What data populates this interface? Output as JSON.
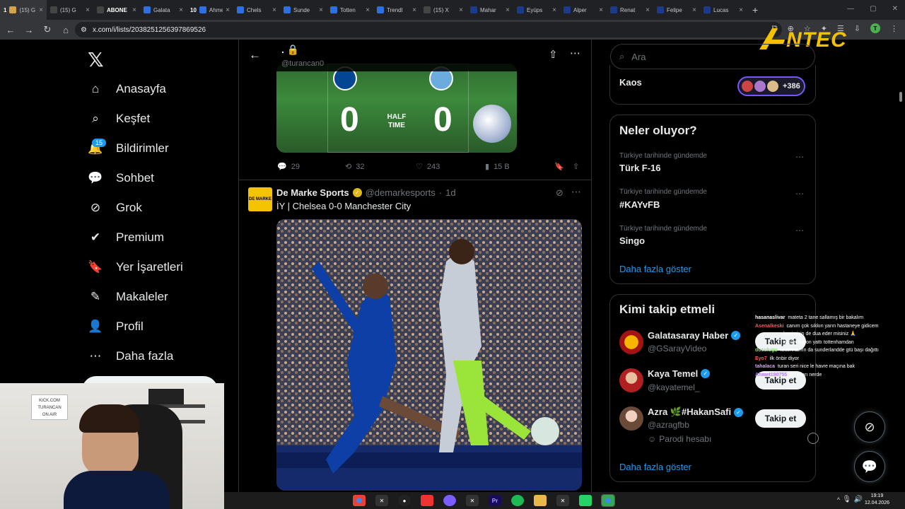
{
  "browser": {
    "tabs": [
      {
        "label": "(15) G",
        "color": "#d4a44a",
        "prefix": "1"
      },
      {
        "label": "(15) G",
        "color": "#444"
      },
      {
        "label": "ABONE",
        "color": "#444"
      },
      {
        "label": "Galata",
        "color": "#2f6fe4"
      },
      {
        "label": "Ahme",
        "color": "#2f6fe4",
        "prefix": "10"
      },
      {
        "label": "Chels",
        "color": "#2f6fe4"
      },
      {
        "label": "Sunde",
        "color": "#2f6fe4"
      },
      {
        "label": "Totten",
        "color": "#2f6fe4"
      },
      {
        "label": "Trendl",
        "color": "#2f6fe4"
      },
      {
        "label": "(15) X",
        "color": "#444"
      },
      {
        "label": "Mahar",
        "color": "#1b3a8a"
      },
      {
        "label": "Eyüps",
        "color": "#1b3a8a"
      },
      {
        "label": "Alper",
        "color": "#1b3a8a"
      },
      {
        "label": "Renat",
        "color": "#1b3a8a"
      },
      {
        "label": "Felipe",
        "color": "#1b3a8a"
      },
      {
        "label": "Lucas",
        "color": "#1b3a8a"
      }
    ],
    "url": "x.com/i/lists/2038251256397869526"
  },
  "overlay": {
    "brand": "Antec"
  },
  "sidebar": {
    "items": [
      {
        "label": "Anasayfa",
        "icon": "home-icon"
      },
      {
        "label": "Keşfet",
        "icon": "search-icon"
      },
      {
        "label": "Bildirimler",
        "icon": "bell-icon"
      },
      {
        "label": "Sohbet",
        "icon": "chat-icon"
      },
      {
        "label": "Grok",
        "icon": "grok-icon"
      },
      {
        "label": "Premium",
        "icon": "verified-icon"
      },
      {
        "label": "Yer İşaretleri",
        "icon": "bookmark-icon"
      },
      {
        "label": "Makaleler",
        "icon": "article-icon"
      },
      {
        "label": "Profil",
        "icon": "profile-icon"
      },
      {
        "label": "Daha fazla",
        "icon": "more-icon"
      }
    ],
    "notification_count": "15"
  },
  "header": {
    "handle": "@turancan0",
    "title": "."
  },
  "post1": {
    "scoreboard": {
      "home_score": "0",
      "away_score": "0",
      "status": "HALF TIME"
    },
    "stats": {
      "replies": "29",
      "reposts": "32",
      "likes": "243",
      "views": "15 B"
    }
  },
  "post2": {
    "author": "De Marke Sports",
    "avatar_text": "DE MARKE",
    "handle": "@demarkesports",
    "time": "1d",
    "text": "İY | Chelsea 0-0 Manchester City"
  },
  "right": {
    "search_placeholder": "Ara",
    "community": {
      "name": "Kaos",
      "count": "+386"
    },
    "trends_title": "Neler oluyor?",
    "trends": [
      {
        "context": "Türkiye tarihinde gündemde",
        "name": "Türk F-16"
      },
      {
        "context": "Türkiye tarihinde gündemde",
        "name": "#KAYvFB"
      },
      {
        "context": "Türkiye tarihinde gündemde",
        "name": "Singo"
      }
    ],
    "show_more": "Daha fazla göster",
    "follow_title": "Kimi takip etmeli",
    "follow": [
      {
        "name": "Galatasaray Haber",
        "handle": "@GSarayVideo",
        "button": "Takip et"
      },
      {
        "name": "Kaya Temel",
        "handle": "@kayatemel_",
        "button": "Takip et"
      },
      {
        "name": "Azra 🌿#HakanSafi",
        "handle": "@azragfbb",
        "note": "Parodi hesabı",
        "button": "Takip et"
      }
    ],
    "show_more_2": "Daha fazla göster"
  },
  "chat": [
    {
      "user": "hasanaslivar",
      "color": "#ffffff",
      "msg": "mateta 2 tane sallamış bir bakalım"
    },
    {
      "user": "Asenalkeski",
      "color": "#ff5a5a",
      "msg": "canım çok sıkkın yarın hastaneye gidicem"
    },
    {
      "user": "",
      "color": "#ffffff",
      "msg": "benimiçin de dua eder misiniz 🙏"
    },
    {
      "user": "",
      "color": "#ffffff",
      "msg": "abinin kupon yattı tottenhamdan"
    },
    {
      "user": "doculugu",
      "color": "#8bdc6a",
      "msg": "tottenhamın da sunderlandde gtü başı dağıttı"
    },
    {
      "user": "Eyo7",
      "color": "#ff5a5a",
      "msg": "ilk önbir diyor"
    },
    {
      "user": "tahalaca",
      "color": "#d8a0ff",
      "msg": "turan seri nice le havre maçına bak"
    },
    {
      "user": "Ahmet190755",
      "color": "#b37cff",
      "msg": "puanları nerde"
    }
  ],
  "webcam": {
    "sign_lines": [
      "KICK.COM",
      "TURANCAN",
      "ON AIR"
    ]
  },
  "taskbar": {
    "time": "19:19",
    "date": "12.04.2026"
  }
}
